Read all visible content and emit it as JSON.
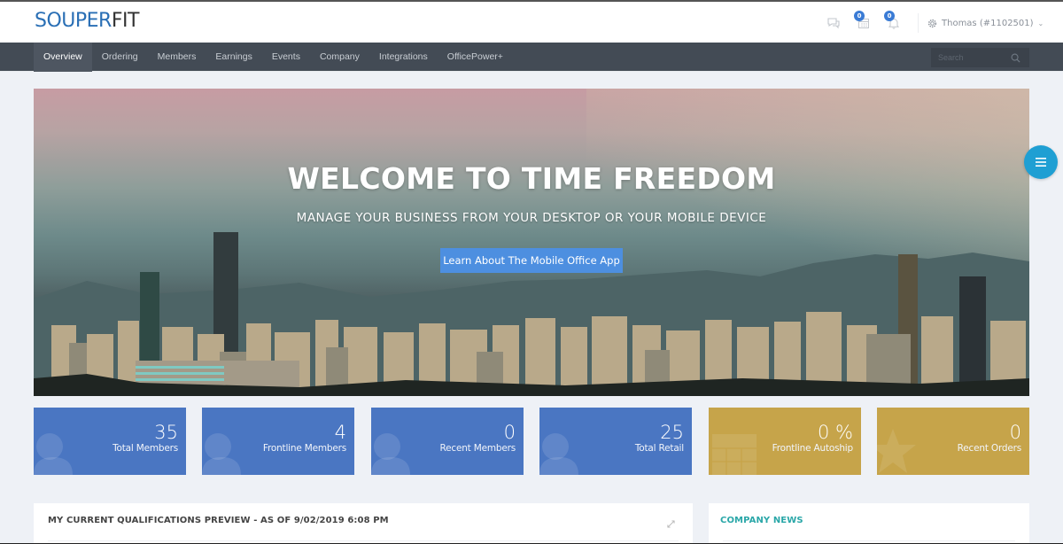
{
  "brand": {
    "part1": "SOUPER",
    "part2": "FIT",
    "color_primary": "#2a6fb5",
    "color_secondary": "#333333"
  },
  "header": {
    "icons": [
      {
        "name": "chat-icon",
        "badge": null
      },
      {
        "name": "calendar-icon",
        "badge": "0"
      },
      {
        "name": "bell-icon",
        "badge": "0"
      }
    ],
    "user_label": "Thomas (#1102501)"
  },
  "nav": {
    "items": [
      {
        "label": "Overview",
        "active": true
      },
      {
        "label": "Ordering",
        "active": false
      },
      {
        "label": "Members",
        "active": false
      },
      {
        "label": "Earnings",
        "active": false
      },
      {
        "label": "Events",
        "active": false
      },
      {
        "label": "Company",
        "active": false
      },
      {
        "label": "Integrations",
        "active": false
      },
      {
        "label": "OfficePower+",
        "active": false
      }
    ],
    "search_placeholder": "Search"
  },
  "hero": {
    "title": "WELCOME TO TIME FREEDOM",
    "subtitle": "MANAGE YOUR BUSINESS FROM YOUR DESKTOP OR YOUR MOBILE DEVICE",
    "button_label": "Learn About The Mobile Office App",
    "button_color": "#4d8fe0"
  },
  "tiles": [
    {
      "value": "35",
      "label": "Total Members",
      "color": "blue",
      "icon": "user-icon"
    },
    {
      "value": "4",
      "label": "Frontline Members",
      "color": "blue",
      "icon": "user-icon"
    },
    {
      "value": "0",
      "label": "Recent Members",
      "color": "blue",
      "icon": "user-icon"
    },
    {
      "value": "25",
      "label": "Total Retail",
      "color": "blue",
      "icon": "user-icon"
    },
    {
      "value": "0 %",
      "label": "Frontline Autoship",
      "color": "gold",
      "icon": "calendar-icon"
    },
    {
      "value": "0",
      "label": "Recent Orders",
      "color": "gold",
      "icon": "star-icon"
    }
  ],
  "panels": {
    "qualifications_title": "MY CURRENT QUALIFICATIONS PREVIEW - AS OF 9/02/2019 6:08 PM",
    "news_title": "COMPANY NEWS"
  },
  "colors": {
    "tile_blue": "#4a76c2",
    "tile_gold": "#c6a44a",
    "nav_bg": "#434b55",
    "fab": "#1f9fd3",
    "news_title": "#2aa7a8"
  }
}
